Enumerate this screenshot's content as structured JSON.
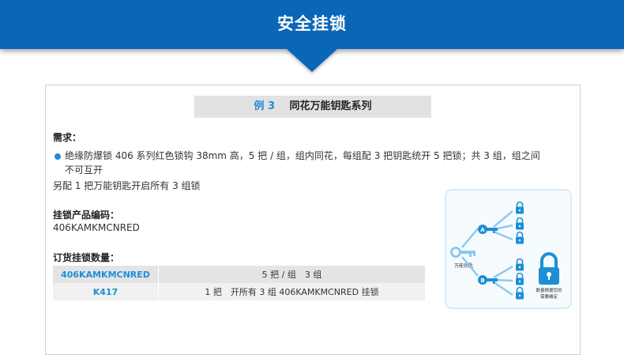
{
  "header": {
    "title": "安全挂锁"
  },
  "example": {
    "number": "例 3",
    "title": "同花万能钥匙系列"
  },
  "requirements": {
    "label": "需求：",
    "bullet_line1": "绝缘防爆锁 406 系列红色锁钩 38mm 高，5 把 / 组，组内同花，每组配 3 把钥匙统开 5 把锁；共 3 组，组之间",
    "bullet_line2": "不可互开",
    "extra": "另配 1 把万能钥匙开启所有 3 组锁"
  },
  "product_code": {
    "label": "挂锁产品编码：",
    "value": "406KAMKMCNRED"
  },
  "order": {
    "label": "订货挂锁数量：",
    "rows": [
      {
        "code": "406KAMKMCNRED",
        "desc": "5 把 / 组　3 组"
      },
      {
        "code": "K417",
        "desc": "1 把　开所有 3 组 406KAMKMCNRED 挂锁"
      }
    ]
  },
  "diagram": {
    "master_key_label": "万能钥匙",
    "key_a": "A",
    "key_b": "B",
    "big_lock_line1": "数量根据您的",
    "big_lock_line2": "需要确定",
    "colors": {
      "accent": "#1c8fd6",
      "header": "#0b66b8",
      "light": "#8ccaf0"
    }
  }
}
